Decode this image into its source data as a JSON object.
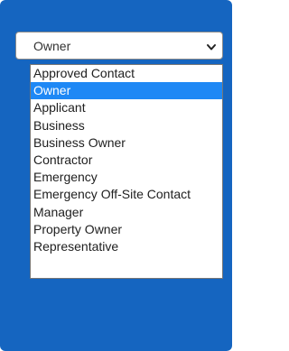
{
  "select": {
    "current_value": "Owner",
    "selected_index": 1,
    "options": [
      "Approved Contact",
      "Owner",
      "Applicant",
      "Business",
      "Business Owner",
      "Contractor",
      "Emergency",
      "Emergency Off-Site Contact",
      "Manager",
      "Property Owner",
      "Representative"
    ]
  },
  "icons": {
    "dropdown_arrow": "chevron-down-icon"
  },
  "colors": {
    "panel_background": "#1565c0",
    "option_highlight": "#1e88f5"
  }
}
